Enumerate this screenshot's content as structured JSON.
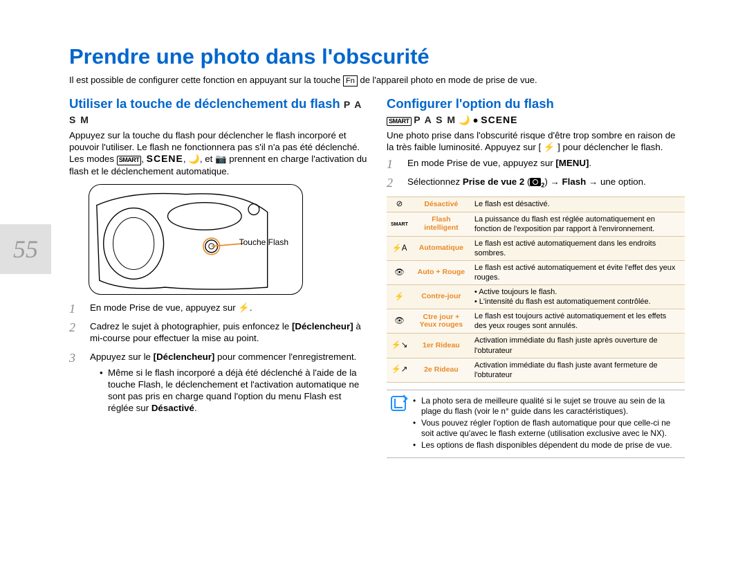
{
  "page_number": "55",
  "title": "Prendre une photo dans l'obscurité",
  "intro_before_fn": "Il est possible de configurer cette fonction en appuyant sur la touche ",
  "intro_fn": "Fn",
  "intro_after_fn": " de l'appareil photo en mode de prise de vue.",
  "left": {
    "heading": "Utiliser la touche de déclenchement du flash ",
    "heading_modes": "P A S M",
    "para_text_a": "Appuyez sur la touche du flash pour déclencher le flash incorporé et pouvoir l'utiliser. Le flash ne fonctionnera pas s'il n'a pas été déclenché. Les modes ",
    "para_text_b": ", ",
    "para_scene": "SCENE",
    "para_text_c": ", 🌙, et 📷 prennent en charge l'activation du flash et le déclenchement automatique.",
    "diagram_label": "Touche Flash",
    "steps": [
      {
        "text": "En mode Prise de vue, appuyez sur ⚡."
      },
      {
        "text": "Cadrez le sujet à photographier, puis enfoncez le [Déclencheur] à mi-course pour effectuer la mise au point.",
        "bold_ranges": [
          [
            "[Déclencheur]"
          ]
        ]
      },
      {
        "text": "Appuyez sur le [Déclencheur] pour commencer l'enregistrement.",
        "bold_ranges": [
          [
            "[Déclencheur]"
          ]
        ],
        "sub": [
          "Même si le flash incorporé a déjà été déclenché à l'aide de la touche Flash, le déclenchement et l'activation automatique ne sont pas pris en charge quand l'option du menu Flash est réglée sur Désactivé."
        ],
        "sub_bold": [
          "Désactivé"
        ]
      }
    ]
  },
  "right": {
    "heading": "Configurer l'option du flash",
    "mode_line_pasm": "P A S M",
    "mode_line_scene": "SCENE",
    "para": "Une photo prise dans l'obscurité risque d'être trop sombre en raison de la très faible luminosité. Appuyez sur [ ⚡ ] pour déclencher le flash.",
    "steps": [
      {
        "line": "En mode Prise de vue, appuyez sur [MENU].",
        "bold": [
          "[MENU]"
        ]
      },
      {
        "line_a": "Sélectionnez ",
        "bold_a": "Prise de vue 2",
        "line_b": " (",
        "line_c": ") → ",
        "bold_b": "Flash",
        "line_d": " → une option."
      }
    ],
    "table": [
      {
        "icon": "⊘",
        "name": "Désactivé",
        "desc": "Le flash est désactivé."
      },
      {
        "icon": "smart",
        "name": "Flash intelligent",
        "desc": "La puissance du flash est réglée automatiquement en fonction de l'exposition par rapport à l'environnement."
      },
      {
        "icon": "⚡A",
        "name": "Automatique",
        "desc": "Le flash est activé automatiquement dans les endroits sombres."
      },
      {
        "icon": "👁",
        "name": "Auto + Rouge",
        "desc": "Le flash est activé automatiquement et évite l'effet des yeux rouges."
      },
      {
        "icon": "⚡",
        "name": "Contre-jour",
        "desc_list": [
          "Active toujours le flash.",
          "L'intensité du flash est automatiquement contrôlée."
        ]
      },
      {
        "icon": "👁",
        "name": "Ctre jour + Yeux rouges",
        "desc": "Le flash est toujours activé automatiquement et les effets des yeux rouges sont annulés."
      },
      {
        "icon": "⚡↘",
        "name": "1er Rideau",
        "desc": "Activation immédiate du flash juste après ouverture de l'obturateur"
      },
      {
        "icon": "⚡↗",
        "name": "2e Rideau",
        "desc": "Activation immédiate du flash juste avant fermeture de l'obturateur"
      }
    ],
    "notes": [
      "La photo sera de meilleure qualité si le sujet se trouve au sein de la plage du flash (voir le n° guide dans les caractéristiques).",
      "Vous pouvez régler l'option de flash automatique pour que celle-ci ne soit active qu'avec le flash externe (utilisation exclusive avec le NX).",
      "Les options de flash disponibles dépendent du mode de prise de vue."
    ]
  }
}
